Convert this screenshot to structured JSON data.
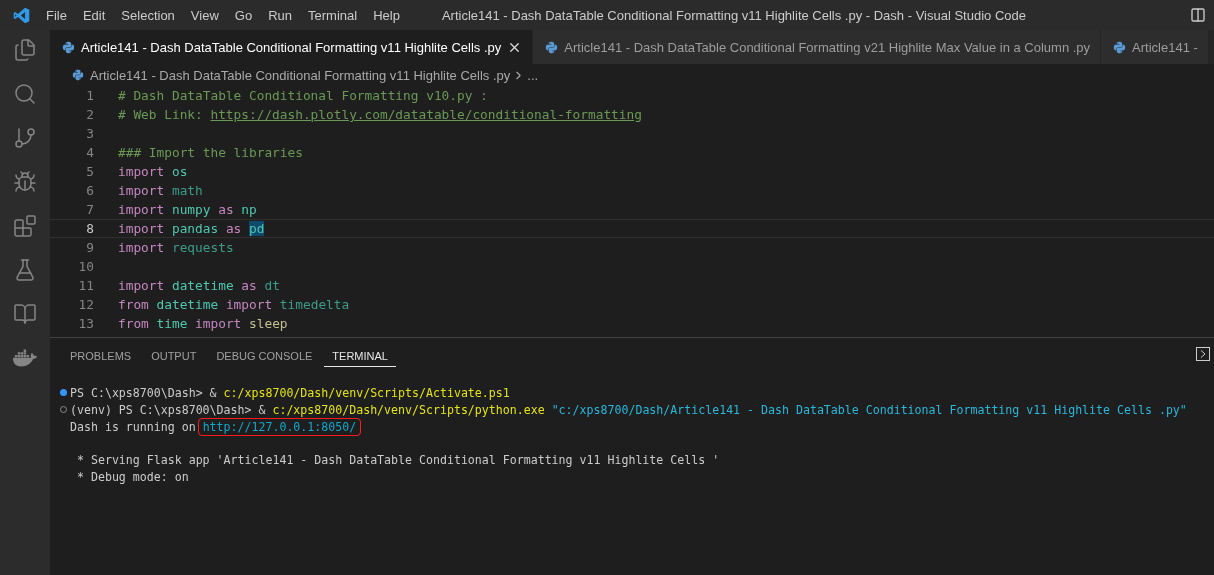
{
  "menu": [
    "File",
    "Edit",
    "Selection",
    "View",
    "Go",
    "Run",
    "Terminal",
    "Help"
  ],
  "window": {
    "title": "Article141 - Dash DataTable Conditional Formatting v11 Highlite Cells .py - Dash - Visual Studio Code"
  },
  "tabs": [
    {
      "label": "Article141 - Dash DataTable Conditional Formatting v11 Highlite Cells .py",
      "selected": true
    },
    {
      "label": "Article141 - Dash DataTable Conditional Formatting v21 Highlite Max Value in a Column .py",
      "selected": false
    },
    {
      "label": "Article141 -",
      "selected": false
    }
  ],
  "breadcrumb": {
    "file": "Article141 - Dash DataTable Conditional Formatting v11 Highlite Cells .py",
    "more": "..."
  },
  "editor": {
    "lines": [
      {
        "number": "1",
        "selected": false,
        "tokens": [
          {
            "text": "# Dash DataTable Conditional Formatting v10.py :",
            "kind": "comment"
          }
        ]
      },
      {
        "number": "2",
        "selected": false,
        "tokens": [
          {
            "text": "# Web Link: ",
            "kind": "comment"
          },
          {
            "text": "https://dash.plotly.com/datatable/conditional-formatting",
            "kind": "link"
          }
        ]
      },
      {
        "number": "3",
        "selected": false
      },
      {
        "number": "4",
        "selected": false,
        "tokens": [
          {
            "text": "### Import the libraries",
            "kind": "comment"
          }
        ]
      },
      {
        "number": "5",
        "selected": false,
        "tokens": [
          {
            "text": "import",
            "kind": "keyword"
          },
          {
            "text": "os",
            "kind": "module"
          }
        ]
      },
      {
        "number": "6",
        "selected": false,
        "tokens": [
          {
            "text": "import",
            "kind": "keyword"
          },
          {
            "text": "math",
            "kind": "faded"
          }
        ]
      },
      {
        "number": "7",
        "selected": false,
        "tokens": [
          {
            "text": "import",
            "kind": "keyword"
          },
          {
            "text": "numpy",
            "kind": "module"
          },
          {
            "text": "as",
            "kind": "keyword"
          },
          {
            "text": "np",
            "kind": "module"
          }
        ]
      },
      {
        "number": "8",
        "selected": true,
        "tokens": [
          {
            "text": "import",
            "kind": "keyword"
          },
          {
            "text": "pandas",
            "kind": "module"
          },
          {
            "text": "as",
            "kind": "keyword"
          },
          {
            "text": "pd",
            "kind": "match"
          }
        ]
      },
      {
        "number": "9",
        "selected": false,
        "tokens": [
          {
            "text": "import",
            "kind": "keyword"
          },
          {
            "text": "requests",
            "kind": "faded"
          }
        ]
      },
      {
        "number": "10",
        "selected": false
      },
      {
        "number": "11",
        "selected": false,
        "tokens": [
          {
            "text": "import",
            "kind": "keyword"
          },
          {
            "text": "datetime",
            "kind": "module"
          },
          {
            "text": "as",
            "kind": "keyword"
          },
          {
            "text": "dt",
            "kind": "faded"
          }
        ]
      },
      {
        "number": "12",
        "selected": false,
        "tokens": [
          {
            "text": "from",
            "kind": "keyword"
          },
          {
            "text": "datetime",
            "kind": "module"
          },
          {
            "text": "import",
            "kind": "keyword"
          },
          {
            "text": "timedelta",
            "kind": "faded"
          }
        ]
      },
      {
        "number": "13",
        "selected": false,
        "tokens": [
          {
            "text": "from",
            "kind": "keyword"
          },
          {
            "text": "time",
            "kind": "module"
          },
          {
            "text": "import",
            "kind": "keyword"
          },
          {
            "text": "sleep",
            "kind": "function"
          }
        ]
      }
    ]
  },
  "panel": {
    "tabs": [
      {
        "label": "PROBLEMS",
        "selected": false
      },
      {
        "label": "OUTPUT",
        "selected": false
      },
      {
        "label": "DEBUG CONSOLE",
        "selected": false
      },
      {
        "label": "TERMINAL",
        "selected": true
      }
    ],
    "terminal": {
      "blocks": [
        [
          {
            "kind": "success",
            "segments": [
              {
                "text": "PS C:\\xps8700\\Dash> & ",
                "kind": "plain"
              },
              {
                "text": "c:/xps8700/Dash/venv/Scripts/Activate.ps1",
                "kind": "path"
              }
            ]
          },
          {
            "kind": "idle",
            "segments": [
              {
                "text": "(venv) PS C:\\xps8700\\Dash> & ",
                "kind": "plain"
              },
              {
                "text": "c:/xps8700/Dash/venv/Scripts/python.exe",
                "kind": "path"
              },
              {
                "text": " \"c:/xps8700/Dash/Article141 - Dash DataTable Conditional Formatting v11 Highlite Cells .py\"",
                "kind": "string"
              }
            ]
          },
          {
            "segments": [
              {
                "text": "Dash is running on ",
                "kind": "plain"
              },
              {
                "text": "http://127.0.0.1:8050/",
                "kind": "boxed_link"
              }
            ]
          }
        ],
        [
          {
            "segments": [
              {
                "text": " * Serving Flask app 'Article141 - Dash DataTable Conditional Formatting v11 Highlite Cells '",
                "kind": "plain"
              }
            ]
          },
          {
            "segments": [
              {
                "text": " * Debug mode: on",
                "kind": "plain"
              }
            ]
          }
        ]
      ]
    }
  }
}
